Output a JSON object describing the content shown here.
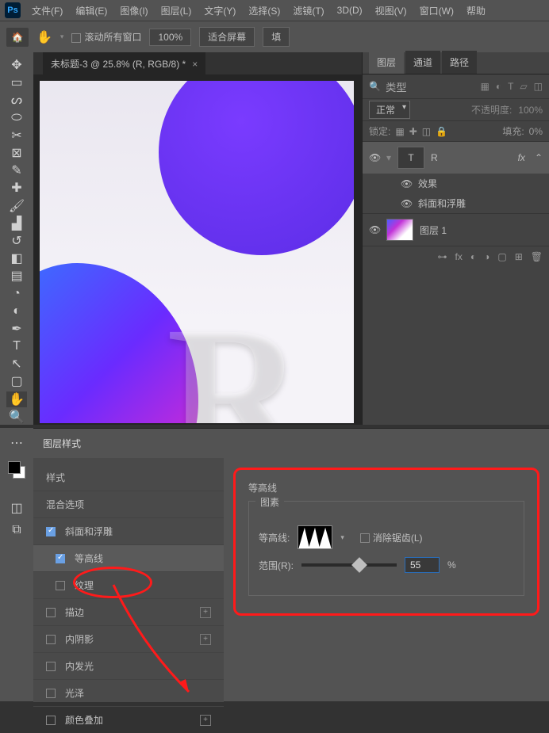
{
  "menu": [
    "文件(F)",
    "编辑(E)",
    "图像(I)",
    "图层(L)",
    "文字(Y)",
    "选择(S)",
    "滤镜(T)",
    "3D(D)",
    "视图(V)",
    "窗口(W)",
    "帮助"
  ],
  "optbar": {
    "scroll_all": "滚动所有窗口",
    "zoom": "100%",
    "fit": "适合屏幕",
    "fill": "填"
  },
  "doc_tab": "未标题-3 @ 25.8% (R, RGB/8) *",
  "layers_panel": {
    "tabs": [
      "图层",
      "通道",
      "路径"
    ],
    "search_icon": "🔍",
    "search_label": "类型",
    "blend": "正常",
    "opacity_label": "不透明度:",
    "opacity_val": "100%",
    "lock_label": "锁定:",
    "fill_label": "填充:",
    "fill_val": "0%",
    "layer_r": "R",
    "fx": "fx",
    "effects": "效果",
    "bevel": "斜面和浮雕",
    "layer1": "图层 1"
  },
  "layer_style": {
    "title": "图层样式",
    "styles": "样式",
    "blend_opts": "混合选项",
    "items": [
      "斜面和浮雕",
      "等高线",
      "纹理",
      "描边",
      "内阴影",
      "内发光",
      "光泽",
      "颜色叠加"
    ],
    "right_title": "等高线",
    "group_title": "图素",
    "contour_label": "等高线:",
    "antialias": "消除锯齿(L)",
    "range_label": "范围(R):",
    "range_val": "55",
    "pct": "%"
  }
}
